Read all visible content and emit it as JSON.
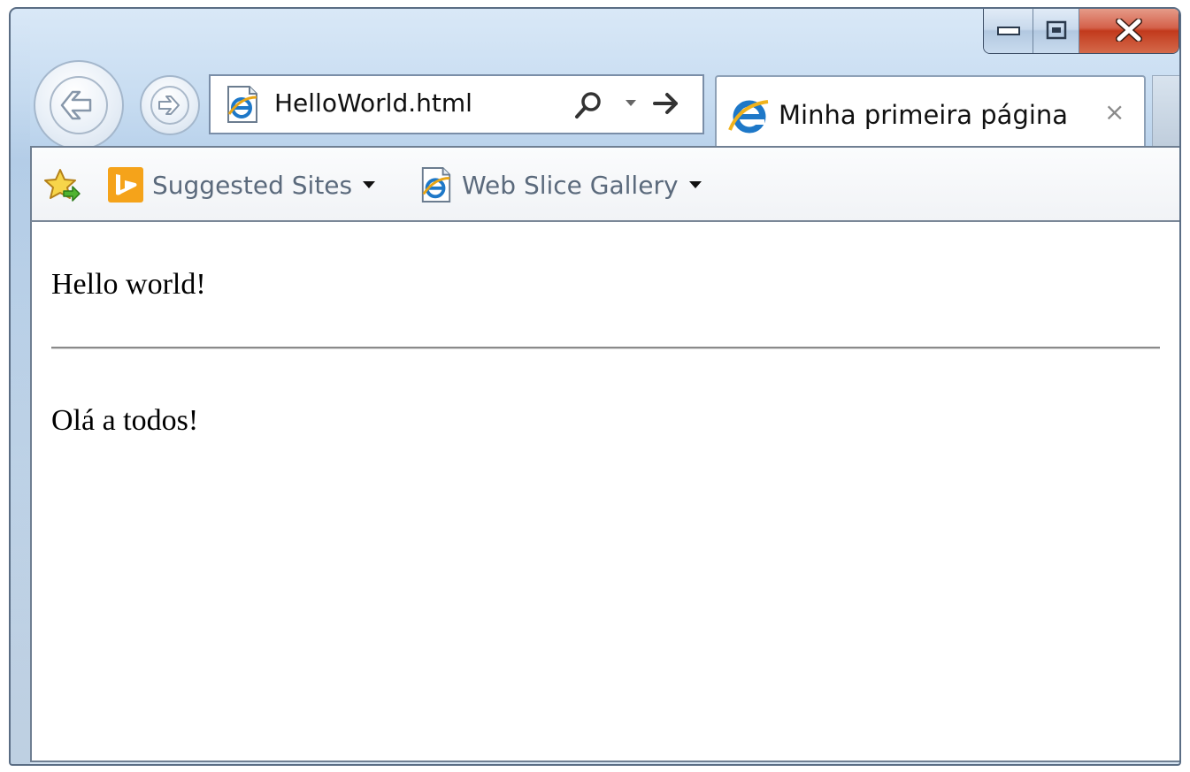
{
  "window": {
    "caption_buttons": {
      "minimize_icon": "minimize-icon",
      "maximize_icon": "restore-icon",
      "close_icon": "close-icon"
    }
  },
  "navigation": {
    "back_icon": "back-arrow-icon",
    "forward_icon": "forward-arrow-icon"
  },
  "address_bar": {
    "value": "HelloWorld.html",
    "page_icon": "ie-page-icon",
    "search_icon": "search-icon",
    "dropdown_icon": "chevron-down-icon",
    "go_icon": "go-arrow-icon"
  },
  "tab": {
    "title": "Minha primeira página",
    "close_label": "×",
    "icon": "ie-logo-icon"
  },
  "favorites_bar": {
    "star_icon": "favorites-star-icon",
    "items": [
      {
        "label": "Suggested Sites",
        "icon": "bing-icon"
      },
      {
        "label": "Web Slice Gallery",
        "icon": "ie-page-icon"
      }
    ]
  },
  "content": {
    "paragraph1": "Hello world!",
    "paragraph2": "Olá a todos!"
  },
  "colors": {
    "frame": "#c7dcf1",
    "close_button": "#c2391c",
    "bing": "#f5a31a",
    "ie_blue": "#1e78c8"
  }
}
